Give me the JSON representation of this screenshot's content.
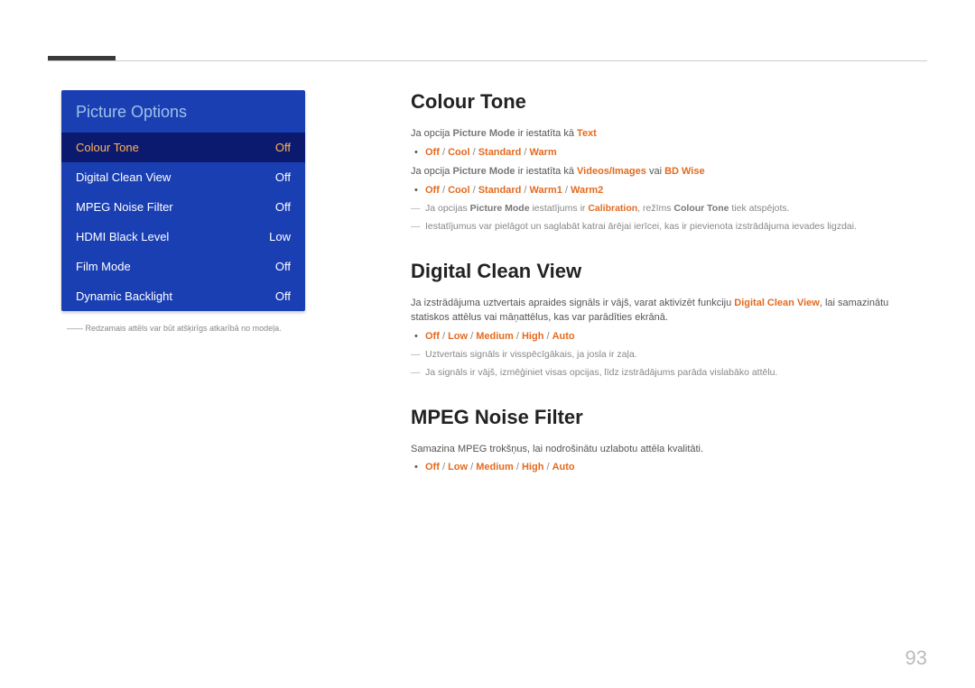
{
  "pageNumber": "93",
  "leftMenu": {
    "title": "Picture Options",
    "items": [
      {
        "label": "Colour Tone",
        "value": "Off",
        "selected": true
      },
      {
        "label": "Digital Clean View",
        "value": "Off",
        "selected": false
      },
      {
        "label": "MPEG Noise Filter",
        "value": "Off",
        "selected": false
      },
      {
        "label": "HDMI Black Level",
        "value": "Low",
        "selected": false
      },
      {
        "label": "Film Mode",
        "value": "Off",
        "selected": false
      },
      {
        "label": "Dynamic Backlight",
        "value": "Off",
        "selected": false
      }
    ],
    "footnote": "――  Redzamais attēls var būt atšķirīgs atkarībā no modeļa."
  },
  "sections": {
    "colourTone": {
      "heading": "Colour Tone",
      "line1_pre": "Ja opcija ",
      "line1_b1": "Picture Mode",
      "line1_mid": " ir iestatīta kā ",
      "line1_b2": "Text",
      "opts1": [
        "Off",
        "Cool",
        "Standard",
        "Warm"
      ],
      "line2_pre": "Ja opcija ",
      "line2_b1": "Picture Mode",
      "line2_mid": " ir iestatīta kā ",
      "line2_b2": "Videos/Images",
      "line2_or": " vai ",
      "line2_b3": "BD Wise",
      "opts2": [
        "Off",
        "Cool",
        "Standard",
        "Warm1",
        "Warm2"
      ],
      "note1_pre": "Ja opcijas ",
      "note1_b1": "Picture Mode",
      "note1_mid": " iestatījums ir ",
      "note1_b2": "Calibration",
      "note1_mid2": ", režīms ",
      "note1_b3": "Colour Tone",
      "note1_post": " tiek atspējots.",
      "note2": "Iestatījumus var pielāgot un saglabāt katrai ārējai ierīcei, kas ir pievienota izstrādājuma ievades ligzdai."
    },
    "digitalCleanView": {
      "heading": "Digital Clean View",
      "desc_pre": "Ja izstrādājuma uztvertais apraides signāls ir vājš, varat aktivizēt funkciju ",
      "desc_b1": "Digital Clean View",
      "desc_post": ", lai samazinātu statiskos attēlus vai māņattēlus, kas var parādīties ekrānā.",
      "opts": [
        "Off",
        "Low",
        "Medium",
        "High",
        "Auto"
      ],
      "note1": "Uztvertais signāls ir visspēcīgākais, ja josla ir zaļa.",
      "note2": "Ja signāls ir vājš, izmēģiniet visas opcijas, līdz izstrādājums parāda vislabāko attēlu."
    },
    "mpegNoiseFilter": {
      "heading": "MPEG Noise Filter",
      "desc": "Samazina MPEG trokšņus, lai nodrošinātu uzlabotu attēla kvalitāti.",
      "opts": [
        "Off",
        "Low",
        "Medium",
        "High",
        "Auto"
      ]
    }
  }
}
